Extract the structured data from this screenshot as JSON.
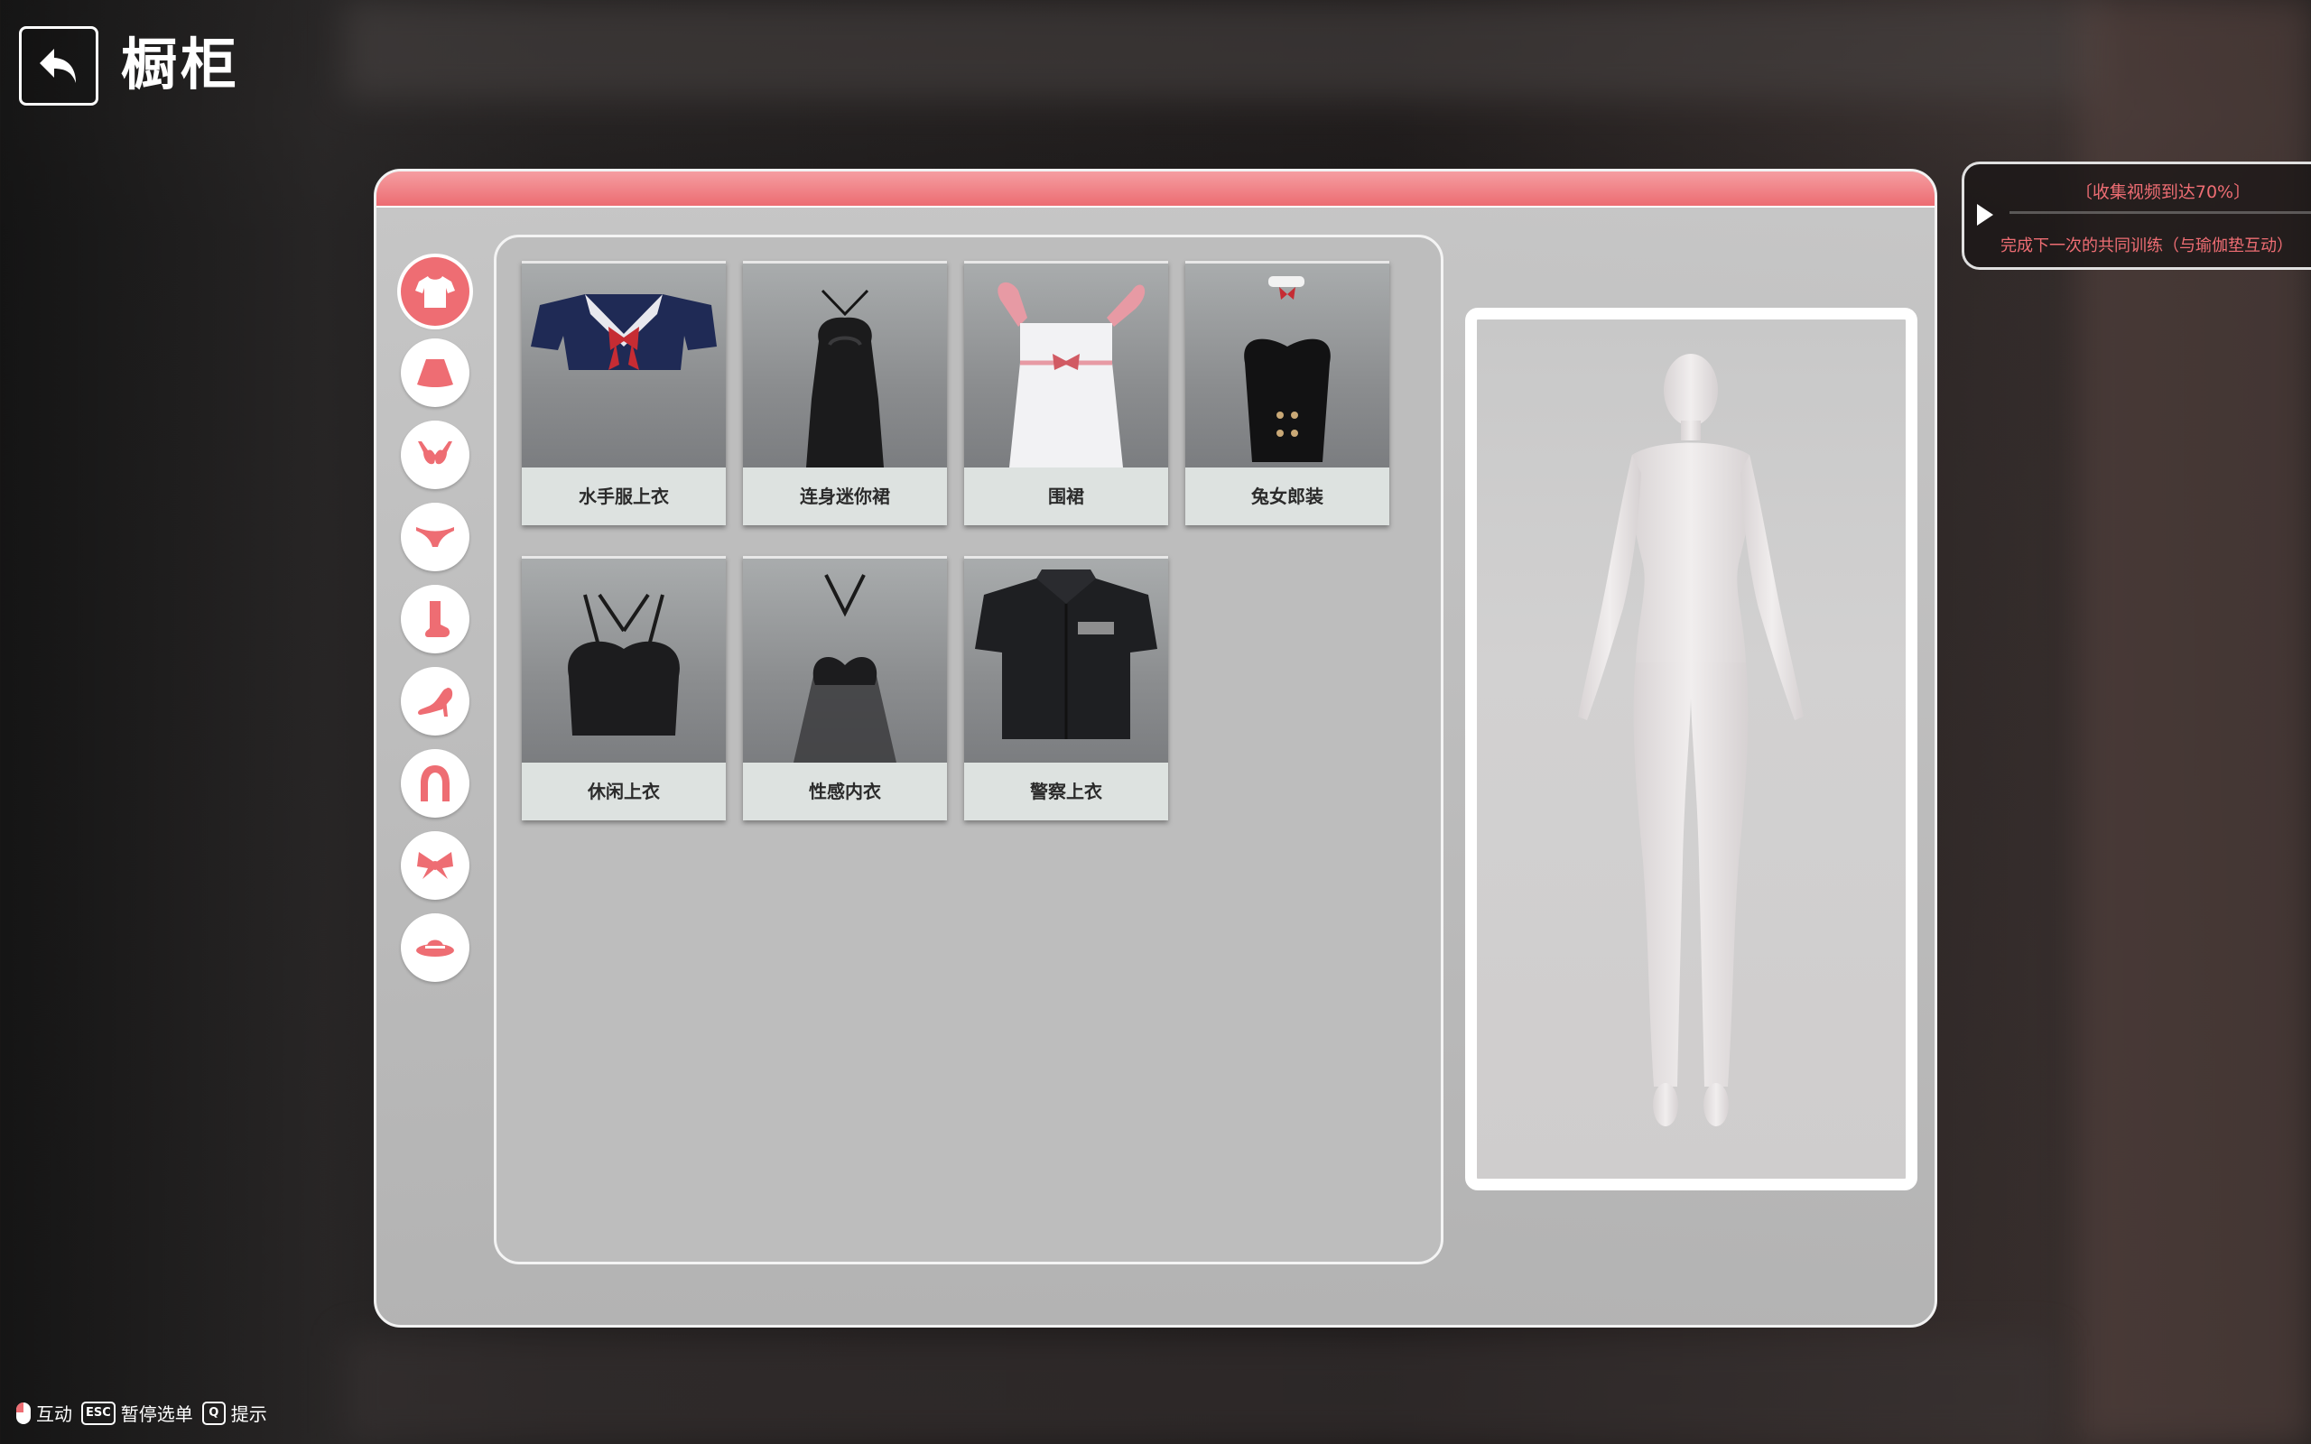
{
  "header": {
    "title": "橱柜"
  },
  "categories": [
    {
      "name": "top",
      "icon": "shirt-icon",
      "active": true
    },
    {
      "name": "skirt",
      "icon": "skirt-icon",
      "active": false
    },
    {
      "name": "bra",
      "icon": "bra-icon",
      "active": false
    },
    {
      "name": "panties",
      "icon": "panties-icon",
      "active": false
    },
    {
      "name": "socks",
      "icon": "sock-icon",
      "active": false
    },
    {
      "name": "shoes",
      "icon": "high-heel-icon",
      "active": false
    },
    {
      "name": "hair",
      "icon": "hair-icon",
      "active": false
    },
    {
      "name": "accessory",
      "icon": "bow-icon",
      "active": false
    },
    {
      "name": "hat",
      "icon": "hat-icon",
      "active": false
    }
  ],
  "items": [
    {
      "label": "水手服上衣",
      "icon": "sailor-top-icon"
    },
    {
      "label": "连身迷你裙",
      "icon": "mini-dress-icon"
    },
    {
      "label": "围裙",
      "icon": "apron-icon"
    },
    {
      "label": "兔女郎装",
      "icon": "bunny-suit-icon"
    },
    {
      "label": "休闲上衣",
      "icon": "casual-top-icon"
    },
    {
      "label": "性感内衣",
      "icon": "lingerie-icon"
    },
    {
      "label": "警察上衣",
      "icon": "police-shirt-icon"
    }
  ],
  "task": {
    "title": "〔收集视频到达70%〕",
    "description": "完成下一次的共同训练（与瑜伽垫互动）"
  },
  "hints": [
    {
      "key": "mouse",
      "label": "互动"
    },
    {
      "key": "ESC",
      "label": "暂停选单"
    },
    {
      "key": "Q",
      "label": "提示"
    }
  ],
  "colors": {
    "accent": "#ee6d73",
    "panel": "#c4c4c4"
  }
}
